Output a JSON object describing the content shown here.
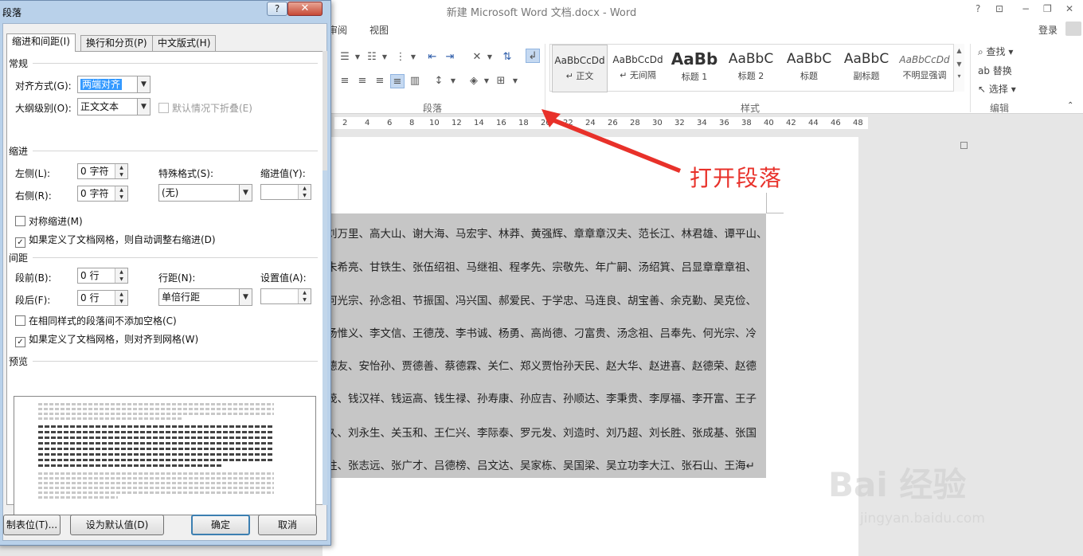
{
  "word": {
    "title": "新建 Microsoft Word 文档.docx - Word",
    "window_controls": [
      "?",
      "⊡",
      "−",
      "❐",
      "✕"
    ],
    "menu": [
      "阅",
      "审阅",
      "视图"
    ],
    "login": "登录",
    "groups": {
      "paragraph": "段落",
      "styles": "样式",
      "edit": "编辑"
    },
    "styles": [
      {
        "sample": "AaBbCcDd",
        "name": "正文"
      },
      {
        "sample": "AaBbCcDd",
        "name": "无间隔"
      },
      {
        "sample": "AaBb",
        "name": "标题 1"
      },
      {
        "sample": "AaBbC",
        "name": "标题 2"
      },
      {
        "sample": "AaBbC",
        "name": "标题"
      },
      {
        "sample": "AaBbC",
        "name": "副标题"
      },
      {
        "sample": "AaBbCcDd",
        "name": "不明显强调"
      }
    ],
    "edit_items": [
      "查找",
      "替换",
      "选择"
    ],
    "ruler_ticks": [
      "2",
      "4",
      "6",
      "8",
      "10",
      "12",
      "14",
      "16",
      "18",
      "20",
      "22",
      "24",
      "26",
      "28",
      "30",
      "32",
      "34",
      "36",
      "38",
      "40",
      "42",
      "44",
      "46",
      "48"
    ],
    "doc_lines": [
      "刘万里、高大山、谢大海、马宏宇、林莽、黄强辉、章章章汉夫、范长江、林君雄、谭平山、",
      "朱希亮、甘铁生、张伍绍祖、马继祖、程孝先、宗敬先、年广嗣、汤绍箕、吕显章章章祖、",
      "何光宗、孙念祖、节振国、冯兴国、郝爱民、于学忠、马连良、胡宝善、余克勤、吴克俭、",
      "杨惟义、李文信、王德茂、李书诚、杨勇、高尚德、刁富贵、汤念祖、吕奉先、何光宗、冷",
      "德友、安怡孙、贾德善、蔡德霖、关仁、郑义贾怡孙天民、赵大华、赵进喜、赵德荣、赵德",
      "茂、钱汉祥、钱运高、钱生禄、孙寿康、孙应吉、孙顺达、李秉贵、李厚福、李开富、王子",
      "久、刘永生、关玉和、王仁兴、李际泰、罗元发、刘造时、刘乃超、刘长胜、张成基、张国",
      "柱、张志远、张广才、吕德榜、吕文达、吴家栋、吴国梁、吴立功李大江、张石山、王海↵"
    ],
    "annotation": "打开段落",
    "watermark": {
      "main": "Bai 经验",
      "sub": "jingyan.baidu.com"
    }
  },
  "dialog": {
    "title": "段落",
    "help": "?",
    "close": "✕",
    "tabs": [
      "缩进和间距(I)",
      "换行和分页(P)",
      "中文版式(H)"
    ],
    "general": {
      "heading": "常规",
      "align_label": "对齐方式(G):",
      "align_value": "两端对齐",
      "outline_label": "大纲级别(O):",
      "outline_value": "正文文本",
      "collapse_label": "默认情况下折叠(E)"
    },
    "indent": {
      "heading": "缩进",
      "left_label": "左侧(L):",
      "left_value": "0 字符",
      "right_label": "右侧(R):",
      "right_value": "0 字符",
      "special_label": "特殊格式(S):",
      "special_value": "(无)",
      "by_label": "缩进值(Y):",
      "mirror_label": "对称缩进(M)",
      "auto_adjust_label": "如果定义了文档网格，则自动调整右缩进(D)"
    },
    "spacing": {
      "heading": "间距",
      "before_label": "段前(B):",
      "before_value": "0 行",
      "after_label": "段后(F):",
      "after_value": "0 行",
      "line_label": "行距(N):",
      "line_value": "单倍行距",
      "at_label": "设置值(A):",
      "no_space_label": "在相同样式的段落间不添加空格(C)",
      "snap_grid_label": "如果定义了文档网格，则对齐到网格(W)"
    },
    "preview_heading": "预览",
    "buttons": {
      "tabs": "制表位(T)...",
      "default": "设为默认值(D)",
      "ok": "确定",
      "cancel": "取消"
    }
  }
}
